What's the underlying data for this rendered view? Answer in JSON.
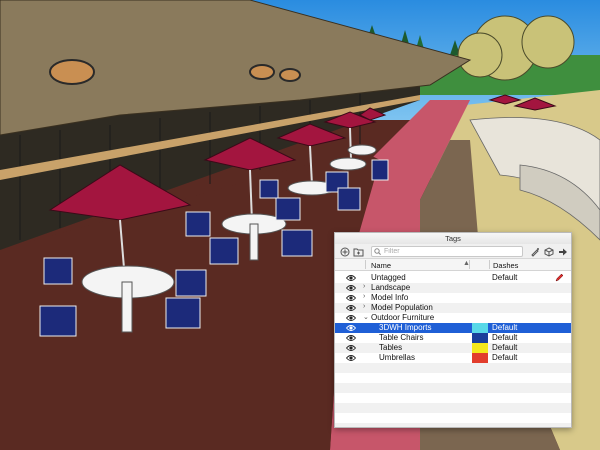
{
  "panel": {
    "title": "Tags",
    "filter_placeholder": "Filter",
    "columns": {
      "name": "Name",
      "dashes": "Dashes"
    }
  },
  "tags": [
    {
      "label": "Untagged",
      "dashes": "Default",
      "color": "",
      "indent": 0,
      "expander": "",
      "selected": false,
      "pencil": true
    },
    {
      "label": "Landscape",
      "dashes": "",
      "color": "",
      "indent": 0,
      "expander": "collapsed",
      "selected": false,
      "pencil": false
    },
    {
      "label": "Model Info",
      "dashes": "",
      "color": "",
      "indent": 0,
      "expander": "collapsed",
      "selected": false,
      "pencil": false
    },
    {
      "label": "Model Population",
      "dashes": "",
      "color": "",
      "indent": 0,
      "expander": "collapsed",
      "selected": false,
      "pencil": false
    },
    {
      "label": "Outdoor Furniture",
      "dashes": "",
      "color": "",
      "indent": 0,
      "expander": "expanded",
      "selected": false,
      "pencil": false
    },
    {
      "label": "3DWH Imports",
      "dashes": "Default",
      "color": "#58d9e8",
      "indent": 1,
      "expander": "",
      "selected": true,
      "pencil": false
    },
    {
      "label": "Table Chairs",
      "dashes": "Default",
      "color": "#1a3f9b",
      "indent": 1,
      "expander": "",
      "selected": false,
      "pencil": false
    },
    {
      "label": "Tables",
      "dashes": "Default",
      "color": "#f4e81c",
      "indent": 1,
      "expander": "",
      "selected": false,
      "pencil": false
    },
    {
      "label": "Umbrellas",
      "dashes": "Default",
      "color": "#e23d2c",
      "indent": 1,
      "expander": "",
      "selected": false,
      "pencil": false
    }
  ],
  "colors": {
    "selection": "#1f5fd6",
    "umbrella": "#a3153f",
    "path": "#c7566a",
    "deck": "#5a2a22"
  }
}
